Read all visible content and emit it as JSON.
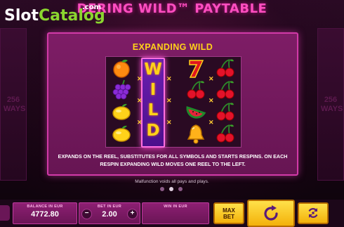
{
  "header": {
    "title": "DERING WILD™ PAYTABLE",
    "logo_slot": "Slot",
    "logo_catalog": "Catalog",
    "logo_domain": ".com"
  },
  "side": {
    "ways_left": "256 WAYS",
    "ways_right": "256 WAYS"
  },
  "paytable": {
    "title": "EXPANDING WILD",
    "wild_letters": [
      "W",
      "I",
      "L",
      "D"
    ],
    "symbols": [
      [
        "orange-icon",
        "wild",
        "seven-icon",
        "cherry-icon"
      ],
      [
        "grapes-icon",
        "wild",
        "cherry-icon",
        "cherry-icon"
      ],
      [
        "lemon-icon",
        "wild",
        "watermelon-icon",
        "cherry-icon"
      ],
      [
        "lemon-icon",
        "wild",
        "bell-icon",
        "cherry-icon"
      ]
    ],
    "description": "EXPANDS ON THE REEL, SUBSTITUTES FOR ALL SYMBOLS AND STARTS RESPINS. ON EACH RESPIN EXPANDING WILD MOVES ONE REEL TO THE LEFT.",
    "malfunction": "Malfunction voids all pays and plays.",
    "pages": 3,
    "current_page": 2
  },
  "controls": {
    "balance_label": "BALANCE IN EUR",
    "balance_value": "4772.80",
    "bet_label": "BET IN EUR",
    "bet_value": "2.00",
    "bet_minus": "−",
    "bet_plus": "+",
    "win_label": "WIN IN EUR",
    "win_value": "",
    "max_bet_line1": "MAX",
    "max_bet_line2": "BET",
    "spin_icon": "spin-arrow-icon",
    "autoplay_icon": "autoplay-icon"
  },
  "colors": {
    "accent_pink": "#d23aa8",
    "title_yellow": "#ffd21a",
    "button_yellow": "#f3b10a"
  }
}
